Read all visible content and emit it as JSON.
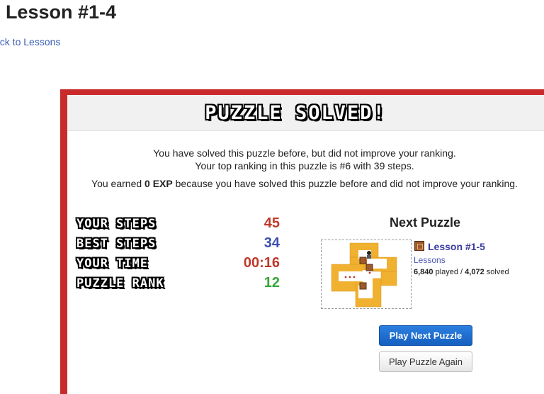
{
  "page": {
    "title": "Lesson #1-4",
    "back_link": "ack to Lessons"
  },
  "modal": {
    "banner": "PUZZLE SOLVED!",
    "message_line1": "You have solved this puzzle before, but did not improve your ranking.",
    "message_line2": "Your top ranking in this puzzle is #6 with 39 steps.",
    "exp_prefix": "You earned ",
    "exp_value": "0 EXP",
    "exp_suffix": " because you have solved this puzzle before and did not improve your ranking."
  },
  "stats": [
    {
      "label": "YOUR STEPS",
      "value": "45",
      "color": "#c0392b"
    },
    {
      "label": "BEST STEPS",
      "value": "34",
      "color": "#3b4fb0"
    },
    {
      "label": "YOUR TIME",
      "value": "00:16",
      "color": "#c0392b"
    },
    {
      "label": "PUZZLE RANK",
      "value": "12",
      "color": "#3aa53a"
    }
  ],
  "next_puzzle": {
    "heading": "Next Puzzle",
    "name": "Lesson #1-5",
    "collection": "Lessons",
    "played_count": "6,840",
    "played_label": " played / ",
    "solved_count": "4,072",
    "solved_label": " solved"
  },
  "buttons": {
    "play_next": "Play Next Puzzle",
    "play_again": "Play Puzzle Again"
  },
  "colors": {
    "modal_border": "#c92b2b",
    "wall": "#f0b030",
    "box": "#9c5a2e",
    "primary_button": "#1f6fd0"
  }
}
